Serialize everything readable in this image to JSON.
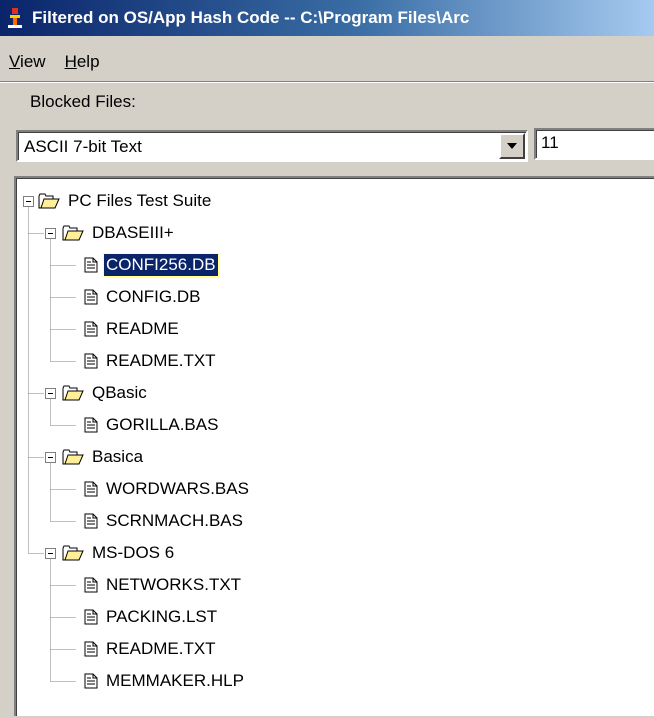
{
  "window": {
    "title": "Filtered on OS/App Hash Code -- C:\\Program Files\\Arc"
  },
  "menubar": {
    "items": [
      {
        "label": "View",
        "underline": "V",
        "rest": "iew"
      },
      {
        "label": "Help",
        "underline": "H",
        "rest": "elp"
      }
    ]
  },
  "blocked_files_label": "Blocked Files:",
  "type_combo": {
    "selected": "ASCII 7-bit Text"
  },
  "count_box": {
    "value": "11"
  },
  "tree": {
    "root": "PC Files Test Suite",
    "folders": [
      {
        "name": "DBASEIII+",
        "files": [
          "CONFI256.DB",
          "CONFIG.DB",
          "README",
          "README.TXT"
        ]
      },
      {
        "name": "QBasic",
        "files": [
          "GORILLA.BAS"
        ]
      },
      {
        "name": "Basica",
        "files": [
          "WORDWARS.BAS",
          "SCRNMACH.BAS"
        ]
      },
      {
        "name": "MS-DOS 6",
        "files": [
          "NETWORKS.TXT",
          "PACKING.LST",
          "README.TXT",
          "MEMMAKER.HLP"
        ]
      }
    ],
    "selected_item": "CONFI256.DB"
  },
  "colors": {
    "title_gradient_start": "#0a246a",
    "title_gradient_end": "#a6caf0",
    "selection": "#0a246a",
    "face": "#d4d0c8"
  },
  "icons": {
    "app": "app-icon",
    "folder": "open-folder-icon",
    "file": "document-icon",
    "expand": "collapse-box-icon",
    "dropdown": "dropdown-arrow-icon"
  }
}
